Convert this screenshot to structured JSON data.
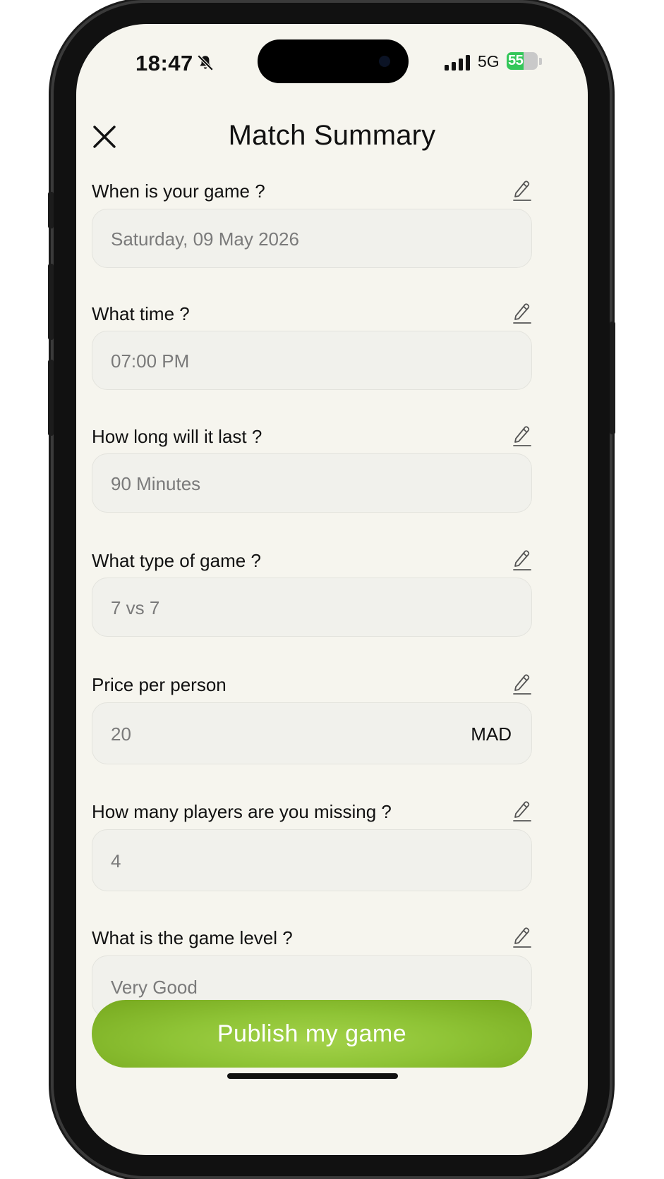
{
  "status_bar": {
    "time": "18:47",
    "network": "5G",
    "battery_level": "55",
    "battery_fraction": 0.55,
    "icons": [
      "bell-slash-icon",
      "cellular-signal-icon",
      "battery-charging-icon"
    ]
  },
  "header": {
    "title": "Match Summary",
    "close_icon": "close-icon"
  },
  "fields": [
    {
      "label": "When is your game ?",
      "value": "Saturday, 09 May 2026"
    },
    {
      "label": "What time ?",
      "value": "07:00 PM"
    },
    {
      "label": "How long will it last ?",
      "value": "90 Minutes"
    },
    {
      "label": "What type of game ?",
      "value": "7 vs 7"
    },
    {
      "label": "Price per person",
      "value": "20",
      "unit": "MAD"
    },
    {
      "label": "How many players are you missing ?",
      "value": "4"
    },
    {
      "label": "What is the game level ?",
      "value": "Very Good"
    }
  ],
  "edit_icon": "pencil-icon",
  "publish": {
    "label": "Publish my game"
  },
  "colors": {
    "background": "#f6f5ee",
    "field_bg": "#f1f1ec",
    "accent_green": "#8fc436",
    "battery_green": "#34c759"
  }
}
